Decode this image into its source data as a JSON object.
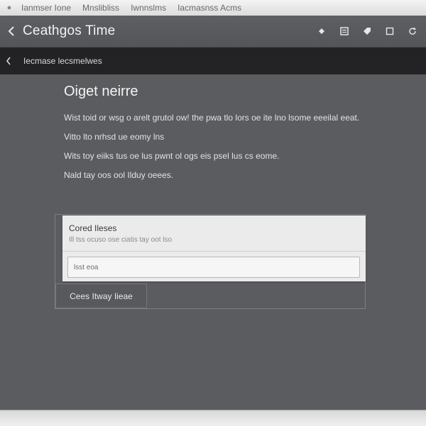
{
  "menubar": {
    "apple_icon": "apple-icon",
    "items": [
      "Ianmser Ione",
      "Mnslibliss",
      "Iwnnslms",
      "Iacmasnss Acms"
    ]
  },
  "header": {
    "title": "Ceathgos Time",
    "back_icon": "chevron-left-icon",
    "tool_icons": [
      "diamond-icon",
      "list-icon",
      "tag-icon",
      "square-icon",
      "refresh-icon"
    ]
  },
  "subnav": {
    "label": "Iecmase lecsmelwes",
    "back_icon": "chevron-left-icon"
  },
  "main": {
    "heading": "Oiget neirre",
    "paragraphs": [
      "Wist toid or wsg o arelt grutol ow! the pwa tlo lors oe ite lno lsome eeeilal eeat.",
      "Vitto lto nrhsd ue eomy lns",
      "Wits toy eiiks tus oe lus pwnt ol ogs eis psel lus cs eome.",
      "Nald tay oos ool Ilduy oeees."
    ]
  },
  "dialog": {
    "title": "Cored Ileses",
    "subtitle": "Ill tss ocuso ose ciatis tay oot lso",
    "input_value": "",
    "input_placeholder": "lsst eoa",
    "secondary_button": "Cees Itway Iieae"
  },
  "colors": {
    "background": "#5b5c5f",
    "subnav": "#232325",
    "card": "#ebebeb"
  }
}
